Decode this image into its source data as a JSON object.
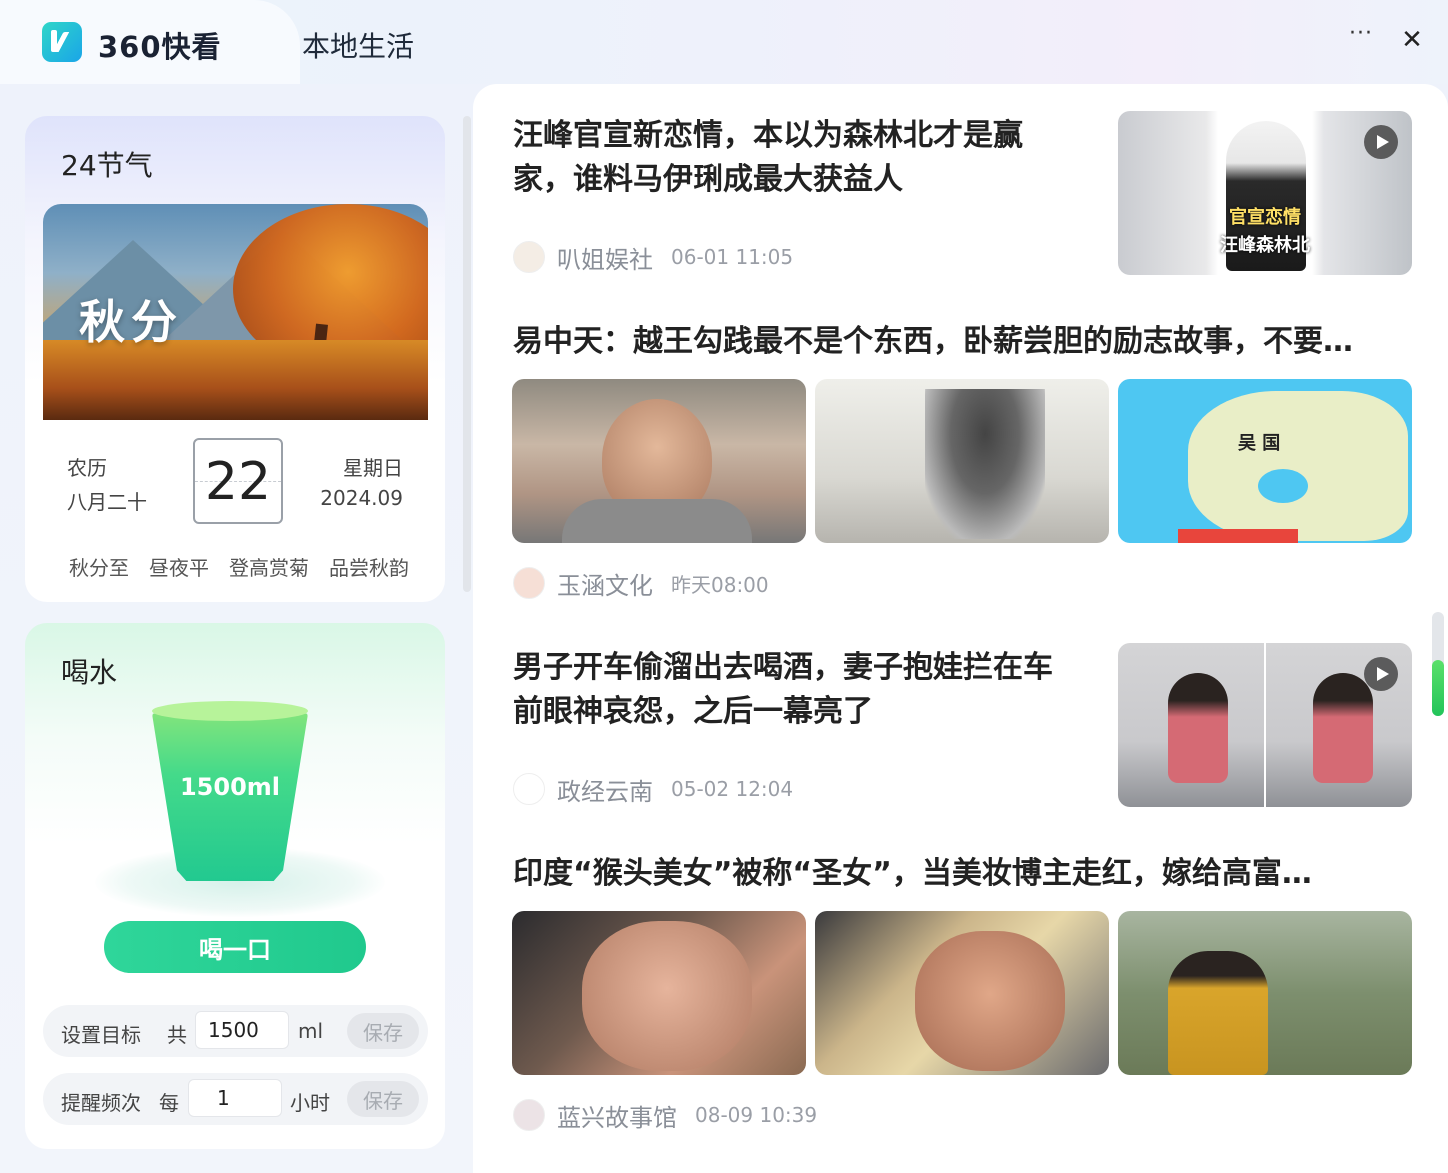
{
  "app": {
    "name": "360快看",
    "tabs": [
      {
        "label": "本地生活"
      }
    ],
    "more_label": "···",
    "close_label": "✕"
  },
  "solar_term": {
    "title": "24节气",
    "name": "秋分",
    "lunar_label": "农历",
    "lunar_date": "八月二十",
    "day": "22",
    "weekday": "星期日",
    "year_month": "2024.09",
    "tags": [
      "秋分至",
      "昼夜平",
      "登高赏菊",
      "品尝秋韵"
    ]
  },
  "water": {
    "title": "喝水",
    "cup_label": "1500ml",
    "drink_button": "喝一口",
    "goal": {
      "label": "设置目标",
      "prefix": "共",
      "value": "1500",
      "unit": "ml",
      "save": "保存"
    },
    "frequency": {
      "label": "提醒频次",
      "prefix": "每",
      "value": "1",
      "unit": "小时",
      "save": "保存"
    }
  },
  "news": [
    {
      "title": "汪峰官宣新恋情，本以为森林北才是赢家，谁料马伊琍成最大获益人",
      "source": "叭姐娱社",
      "time": "06-01 11:05",
      "thumb_text": [
        "官宣恋情",
        "汪峰森林北"
      ],
      "has_video": true
    },
    {
      "title": "易中天：越王勾践最不是个东西，卧薪尝胆的励志故事，不要…",
      "source": "玉涵文化",
      "time": "昨天08:00",
      "map_labels": [
        "吴 国"
      ]
    },
    {
      "title": "男子开车偷溜出去喝酒，妻子抱娃拦在车前眼神哀怨，之后一幕亮了",
      "source": "政经云南",
      "time": "05-02 12:04",
      "has_video": true
    },
    {
      "title": "印度“猴头美女”被称“圣女”，当美妆博主走红，嫁给高富…",
      "source": "蓝兴故事馆",
      "time": "08-09 10:39"
    }
  ],
  "colors": {
    "accent_green": "#22c98d",
    "scroll_green": "#22c45a",
    "logo_cyan": "#1aa5e8"
  }
}
